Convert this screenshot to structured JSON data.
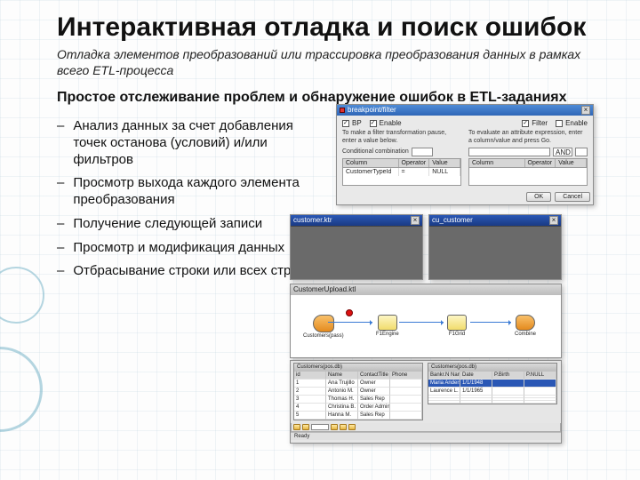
{
  "title": "Интерактивная отладка и поиск ошибок",
  "subtitle": "Отладка элементов преобразований или трассировка преобразования данных в рамках всего ETL-процесса",
  "heading": "Простое отслеживание проблем и обнаружение ошибок в ETL-заданиях",
  "bullets": [
    "Анализ данных за счет добавления точек останова (условий) и/или фильтров",
    "Просмотр выхода каждого элемента преобразования",
    "Получение следующей записи",
    "Просмотр и модификация данных",
    "Отбрасывание строки или всех строк"
  ],
  "dialog": {
    "title": "breakpoint/filter",
    "chk_bp": "Enable",
    "chk_bp_label": "BP",
    "chk_flt": "Enable",
    "chk_flt_label": "Filter",
    "hint_left": "To make a filter transformation pause, enter a value below.",
    "hint_right": "To evaluate an attribute expression, enter a column/value and press Go.",
    "cond_label": "Conditional combination",
    "grid_head": [
      "Column",
      "Operator",
      "Value"
    ],
    "grid_rows": [
      [
        "CustomerTypeId",
        "=",
        "NULL"
      ]
    ],
    "r_combo_label": "AND",
    "buttons": {
      "ok": "OK",
      "cancel": "Cancel"
    }
  },
  "trace": {
    "title": "customer.ktr",
    "title2": "cu_customer"
  },
  "flow": {
    "title": "CustomerUpload.ktl",
    "nodes": [
      "Customers(pass)",
      "F1Engine",
      "F1Grid",
      "Combine"
    ]
  },
  "gridL": {
    "title": "Customers(pos.db)",
    "cols": [
      "id",
      "Name",
      "ContactTitle",
      "Phone"
    ],
    "rows": [
      [
        "1",
        "Ana Trujillo",
        "Owner",
        ""
      ],
      [
        "2",
        "Antonio M.",
        "Owner",
        ""
      ],
      [
        "3",
        "Thomas H.",
        "Sales Rep",
        ""
      ],
      [
        "4",
        "Christina B.",
        "Order Admin",
        ""
      ],
      [
        "5",
        "Hanna M.",
        "Sales Rep",
        ""
      ]
    ]
  },
  "gridR": {
    "title": "Customers(pos.db)",
    "cols": [
      "Bankr.N Name",
      "Date",
      "P.Birth",
      "P.NULL"
    ],
    "rows": [
      [
        "Maria Anders",
        "1/1/1948",
        "",
        ""
      ],
      [
        "Laurence L.",
        "1/1/1965",
        "",
        ""
      ]
    ]
  },
  "status": "Ready"
}
